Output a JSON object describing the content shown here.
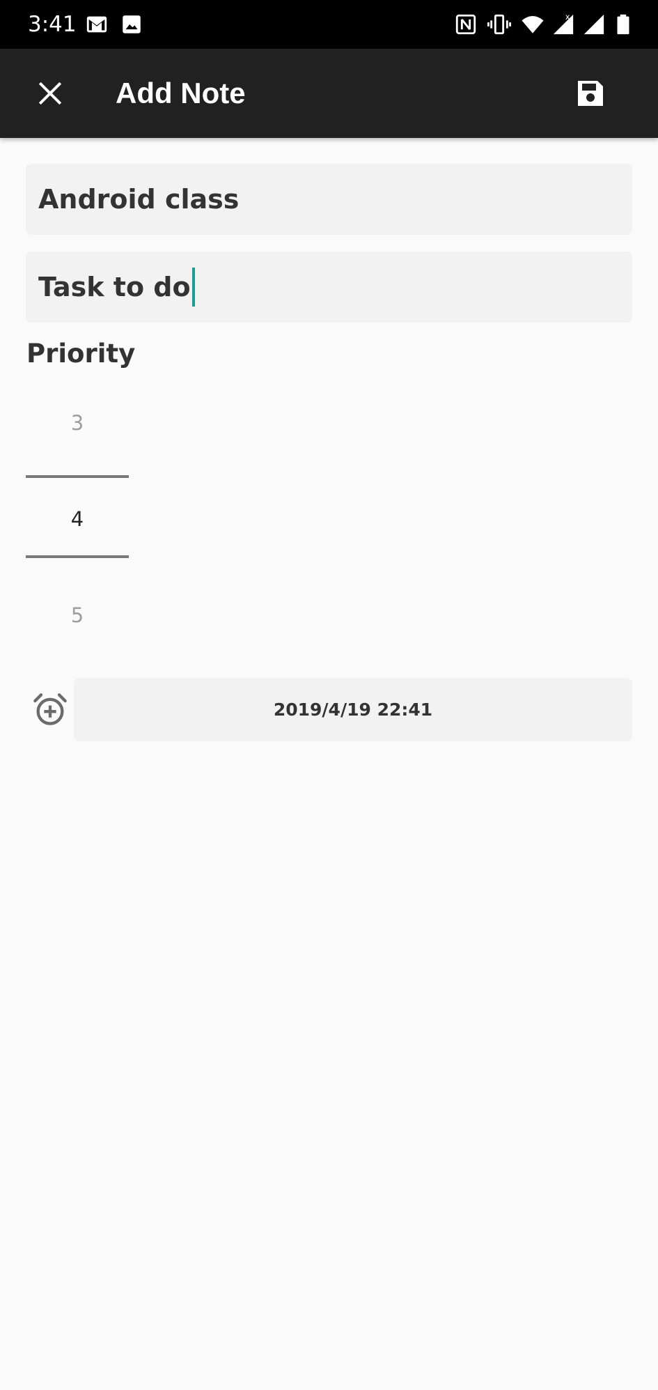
{
  "status_bar": {
    "time": "3:41",
    "left_icons": [
      "gmail-icon",
      "image-icon"
    ],
    "right_icons": [
      "nfc-icon",
      "vibrate-icon",
      "wifi-icon",
      "signal-icon",
      "signal-icon",
      "battery-icon"
    ]
  },
  "app_bar": {
    "title": "Add Note",
    "close_icon": "close-icon",
    "save_icon": "save-icon"
  },
  "form": {
    "title_value": "Android class",
    "description_value": "Task to do",
    "priority_label": "Priority",
    "priority_picker": {
      "previous": "3",
      "current": "4",
      "next": "5"
    },
    "reminder": {
      "icon": "alarm-add-icon",
      "date_value": "2019/4/19 22:41"
    }
  },
  "colors": {
    "status_bar": "#000000",
    "app_bar": "#212121",
    "background": "#fafafa",
    "field_background": "#f2f2f2",
    "caret": "#1a9e8f"
  }
}
